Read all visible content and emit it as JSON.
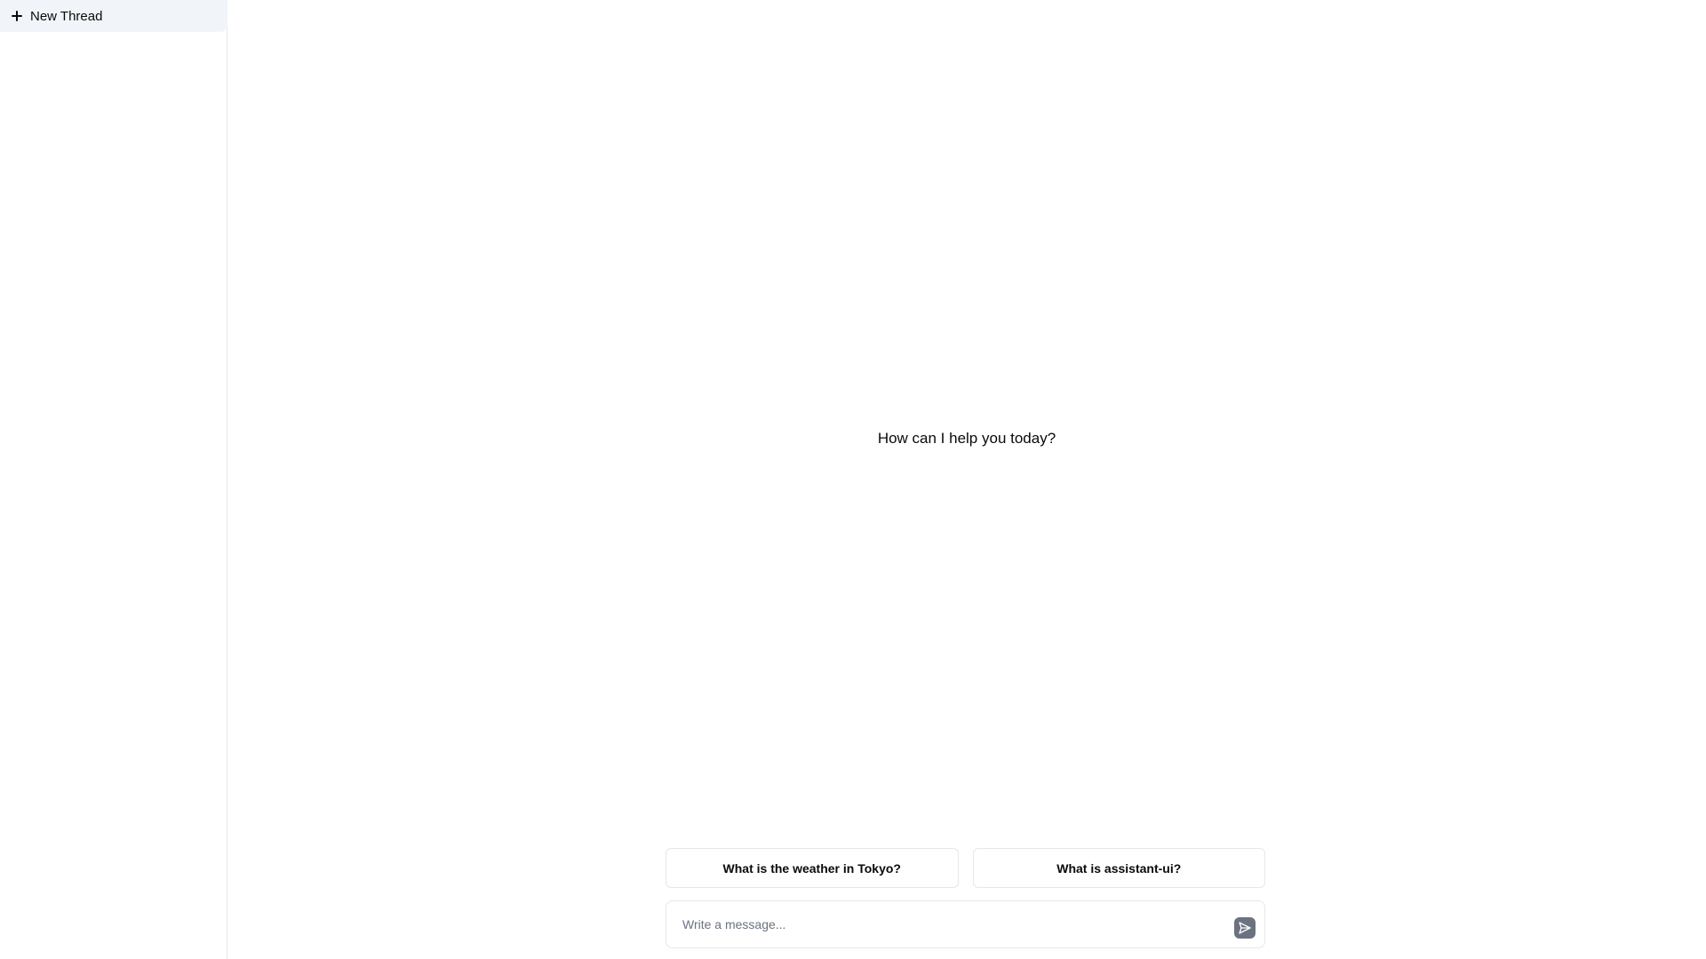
{
  "sidebar": {
    "new_thread_label": "New Thread"
  },
  "main": {
    "welcome_text": "How can I help you today?",
    "suggestions": [
      {
        "label": "What is the weather in Tokyo?"
      },
      {
        "label": "What is assistant-ui?"
      }
    ],
    "composer": {
      "placeholder": "Write a message...",
      "value": ""
    }
  },
  "colors": {
    "sidebar_button_bg": "#f1f5f9",
    "border": "#e5e7eb",
    "send_button_bg": "#6b7280",
    "text": "#0a0a0a",
    "placeholder": "#6b7280"
  },
  "icons": {
    "new_thread": "plus-icon",
    "send": "send-icon"
  }
}
